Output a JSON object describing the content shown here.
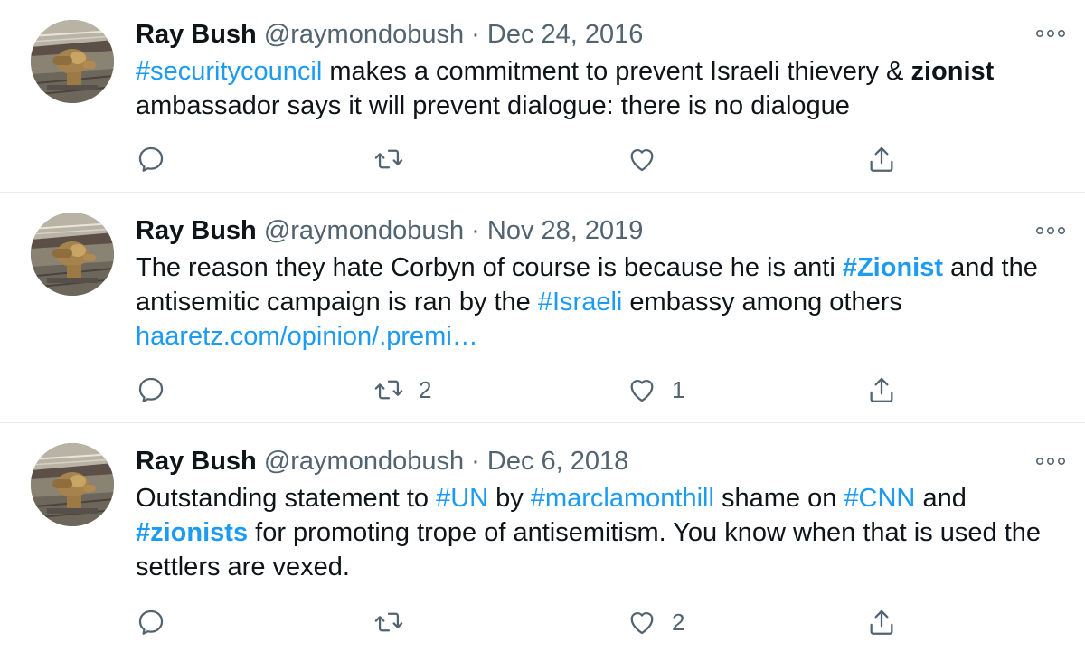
{
  "tweets": [
    {
      "name": "Ray Bush",
      "handle": "@raymondobush",
      "separator": "·",
      "date": "Dec 24, 2016",
      "text": {
        "t1": "#securitycouncil",
        "t2": " makes a commitment to prevent Israeli thievery & ",
        "t3": "zionist",
        "t4": " ambassador says it will prevent dialogue: there is no dialogue"
      },
      "retweets": "",
      "likes": ""
    },
    {
      "name": "Ray Bush",
      "handle": "@raymondobush",
      "separator": "·",
      "date": "Nov 28, 2019",
      "text": {
        "t1": "The reason they hate Corbyn of course is because he is anti ",
        "t2": "#Zionist",
        "t3": " and the antisemitic campaign is ran by the ",
        "t4": "#Israeli",
        "t5": " embassy among others",
        "link": "haaretz.com/opinion/.premi…"
      },
      "retweets": "2",
      "likes": "1"
    },
    {
      "name": "Ray Bush",
      "handle": "@raymondobush",
      "separator": "·",
      "date": "Dec 6, 2018",
      "text": {
        "t1": "Outstanding statement to ",
        "t2": "#UN",
        "t3": " by ",
        "t4": "#marclamonthill",
        "t5": " shame on ",
        "t6": "#CNN",
        "t7": " and ",
        "t8": "#zionists",
        "t9": " for promoting trope of antisemitism. You know when that is used the settlers are vexed."
      },
      "retweets": "",
      "likes": "2"
    }
  ],
  "colors": {
    "accent": "#1d9bf0",
    "text": "#0f1419",
    "secondary": "#536471",
    "divider": "#e6ecf0"
  },
  "icons": [
    "reply-icon",
    "retweet-icon",
    "like-icon",
    "share-icon",
    "more-icon",
    "avatar-image"
  ]
}
